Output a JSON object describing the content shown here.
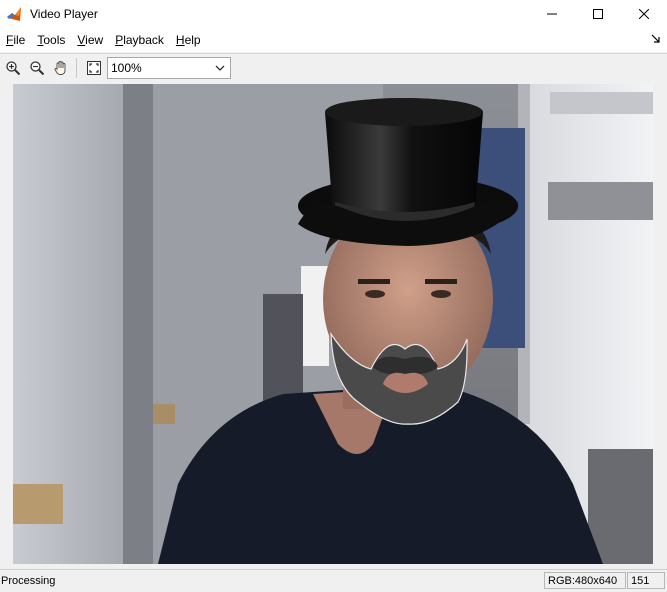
{
  "window": {
    "title": "Video Player",
    "icon": "matlab-icon"
  },
  "menu": {
    "items": [
      {
        "label": "File",
        "underline": "F"
      },
      {
        "label": "Tools",
        "underline": "T"
      },
      {
        "label": "View",
        "underline": "V"
      },
      {
        "label": "Playback",
        "underline": "P"
      },
      {
        "label": "Help",
        "underline": "H"
      }
    ]
  },
  "toolbar": {
    "buttons": [
      "zoom-in-icon",
      "zoom-out-icon",
      "pan-hand-icon",
      "fit-to-window-icon"
    ],
    "zoom_value": "100%"
  },
  "video": {
    "description": "webcam frame with top hat and beard overlays"
  },
  "status": {
    "state": "Processing",
    "info": "RGB:480x640",
    "frame": "151"
  },
  "colors": {
    "title_bg": "#ffffff",
    "chrome_bg": "#f0f0f0",
    "hat": "#111111",
    "beard": "#4a4a4a"
  }
}
